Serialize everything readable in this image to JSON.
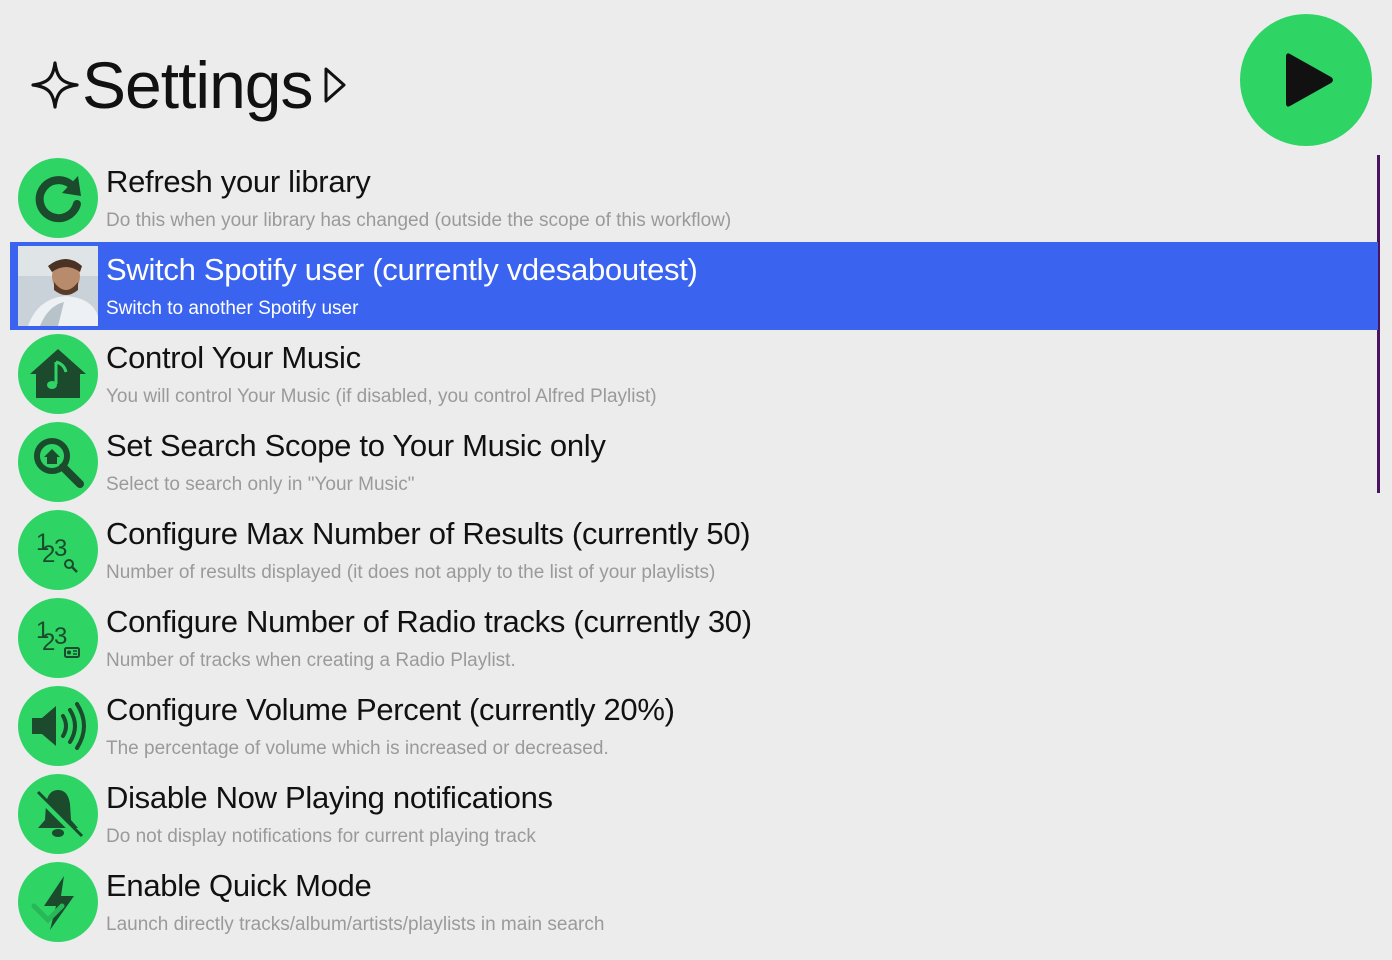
{
  "header": {
    "title": "Settings"
  },
  "rows": [
    {
      "title": "Refresh your library",
      "subtitle": "Do this when your library has changed (outside the scope of this workflow)",
      "icon": "refresh-icon"
    },
    {
      "title": "Switch Spotify user (currently vdesaboutest)",
      "subtitle": "Switch to another Spotify user",
      "icon": "user-avatar",
      "selected": true
    },
    {
      "title": "Control Your Music",
      "subtitle": "You will control Your Music (if disabled, you control Alfred Playlist)",
      "icon": "home-music-icon"
    },
    {
      "title": "Set Search Scope to Your Music only",
      "subtitle": "Select to search only in \"Your Music\"",
      "icon": "search-home-icon"
    },
    {
      "title": "Configure Max Number of Results (currently 50)",
      "subtitle": "Number of results displayed (it does not apply to the list of your playlists)",
      "icon": "numbers-search-icon"
    },
    {
      "title": "Configure Number of Radio tracks (currently 30)",
      "subtitle": "Number of tracks when creating a Radio Playlist.",
      "icon": "numbers-radio-icon"
    },
    {
      "title": "Configure Volume Percent (currently 20%)",
      "subtitle": "The percentage of volume which is increased or decreased.",
      "icon": "volume-icon"
    },
    {
      "title": "Disable Now Playing notifications",
      "subtitle": "Do not display notifications for current playing track",
      "icon": "bell-off-icon"
    },
    {
      "title": "Enable Quick Mode",
      "subtitle": "Launch directly tracks/album/artists/playlists in main search",
      "icon": "lightning-icon"
    }
  ],
  "colors": {
    "accent_green": "#2ed565",
    "selection_blue": "#3a64ef",
    "scrollbar": "#4a1460"
  }
}
